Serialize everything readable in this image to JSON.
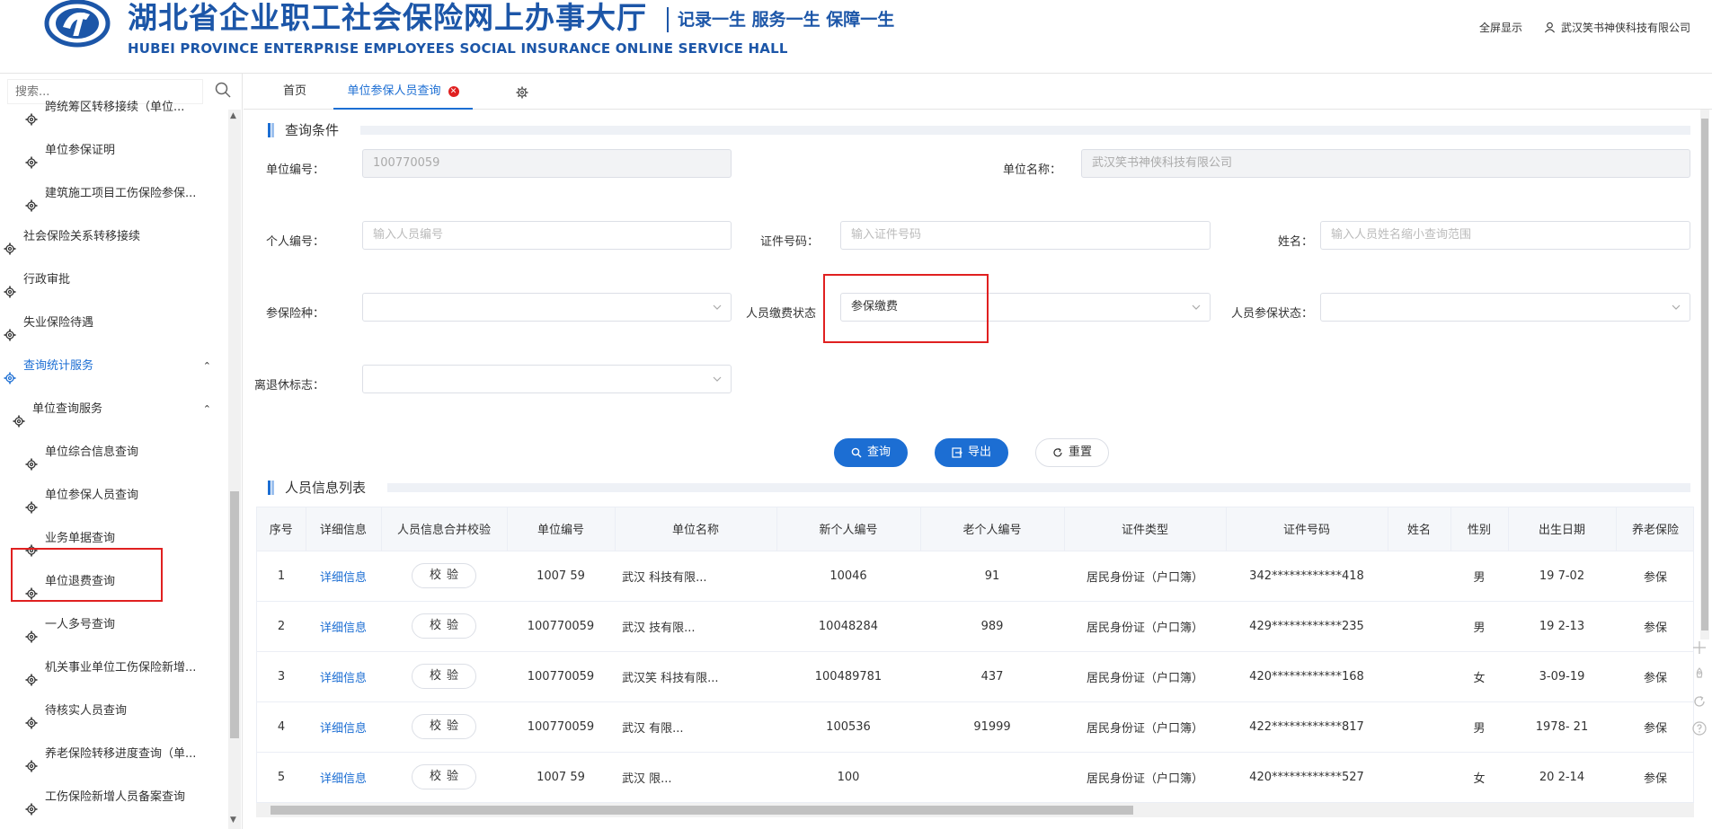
{
  "header": {
    "title_cn": "湖北省企业职工社会保险网上办事大厅",
    "slogan": "记录一生 服务一生 保障一生",
    "title_en": "HUBEI PROVINCE ENTERPRISE EMPLOYEES SOCIAL INSURANCE ONLINE SERVICE HALL",
    "fullscreen": "全屏显示",
    "user": "武汉笑书神侠科技有限公司",
    "brand_color": "#1c56a8"
  },
  "sidebar": {
    "search_placeholder": "搜索...",
    "items": [
      {
        "label": "跨统筹区转移接续（单位...",
        "indent": 2
      },
      {
        "label": "单位参保证明",
        "indent": 2
      },
      {
        "label": "建筑施工项目工伤保险参保...",
        "indent": 2
      },
      {
        "label": "社会保险关系转移接续",
        "indent": 0
      },
      {
        "label": "行政审批",
        "indent": 0
      },
      {
        "label": "失业保险待遇",
        "indent": 0
      },
      {
        "label": "查询统计服务",
        "indent": 0
      },
      {
        "label": "单位查询服务",
        "indent": 1
      },
      {
        "label": "单位综合信息查询",
        "indent": 2
      },
      {
        "label": "单位参保人员查询",
        "indent": 2
      },
      {
        "label": "业务单据查询",
        "indent": 2
      },
      {
        "label": "单位退费查询",
        "indent": 2
      },
      {
        "label": "一人多号查询",
        "indent": 2
      },
      {
        "label": "机关事业单位工伤保险新增...",
        "indent": 2
      },
      {
        "label": "待核实人员查询",
        "indent": 2
      },
      {
        "label": "养老保险转移进度查询（单...",
        "indent": 2
      },
      {
        "label": "工伤保险新增人员备案查询",
        "indent": 2
      }
    ]
  },
  "tabs": {
    "home": "首页",
    "active": "单位参保人员查询"
  },
  "query": {
    "title": "查询条件",
    "unit_no_label": "单位编号：",
    "unit_no_value": "100770059",
    "unit_name_label": "单位名称：",
    "unit_name_value": "武汉笑书神侠科技有限公司",
    "person_no_label": "个人编号：",
    "person_no_placeholder": "输入人员编号",
    "id_no_label": "证件号码：",
    "id_no_placeholder": "输入证件号码",
    "name_label": "姓名：",
    "name_placeholder": "输入人员姓名缩小查询范围",
    "insurance_type_label": "参保险种：",
    "pay_status_label": "人员缴费状态",
    "pay_status_value": "参保缴费",
    "insured_status_label": "人员参保状态：",
    "retire_label": "离退休标志：",
    "btn_query": "查询",
    "btn_export": "导出",
    "btn_reset": "重置"
  },
  "list": {
    "title": "人员信息列表",
    "columns": [
      "序号",
      "详细信息",
      "人员信息合并校验",
      "单位编号",
      "单位名称",
      "新个人编号",
      "老个人编号",
      "证件类型",
      "证件号码",
      "姓名",
      "性别",
      "出生日期",
      "养老保险"
    ],
    "check_label": "校验",
    "detail_label": "详细信息",
    "rows": [
      {
        "no": "1",
        "unit_no": "1007   59",
        "unit_name": "武汉     科技有限...",
        "new_no": "10046",
        "old_no": "91",
        "id_type": "居民身份证（户口簿）",
        "id_no": "342************418",
        "name": "",
        "sex": "男",
        "birth": "19   7-02",
        "pension": "参保"
      },
      {
        "no": "2",
        "unit_no": "100770059",
        "unit_name": "武汉     技有限...",
        "new_no": "10048284",
        "old_no": "989",
        "id_type": "居民身份证（户口簿）",
        "id_no": "429************235",
        "name": "",
        "sex": "男",
        "birth": "19   2-13",
        "pension": "参保"
      },
      {
        "no": "3",
        "unit_no": "100770059",
        "unit_name": "武汉笑     科技有限...",
        "new_no": "100489781",
        "old_no": "437",
        "id_type": "居民身份证（户口簿）",
        "id_no": "420************168",
        "name": "",
        "sex": "女",
        "birth": "   3-09-19",
        "pension": "参保"
      },
      {
        "no": "4",
        "unit_no": "100770059",
        "unit_name": "武汉       有限...",
        "new_no": "100536",
        "old_no": "91999",
        "id_type": "居民身份证（户口簿）",
        "id_no": "422************817",
        "name": "",
        "sex": "男",
        "birth": "1978-   21",
        "pension": "参保"
      },
      {
        "no": "5",
        "unit_no": "1007   59",
        "unit_name": "武汉       限...",
        "new_no": "100",
        "old_no": "",
        "id_type": "居民身份证（户口簿）",
        "id_no": "420************527",
        "name": "",
        "sex": "女",
        "birth": "20   2-14",
        "pension": "参保"
      }
    ]
  },
  "colors": {
    "primary": "#1c6ed3",
    "highlight": "#e02020"
  }
}
